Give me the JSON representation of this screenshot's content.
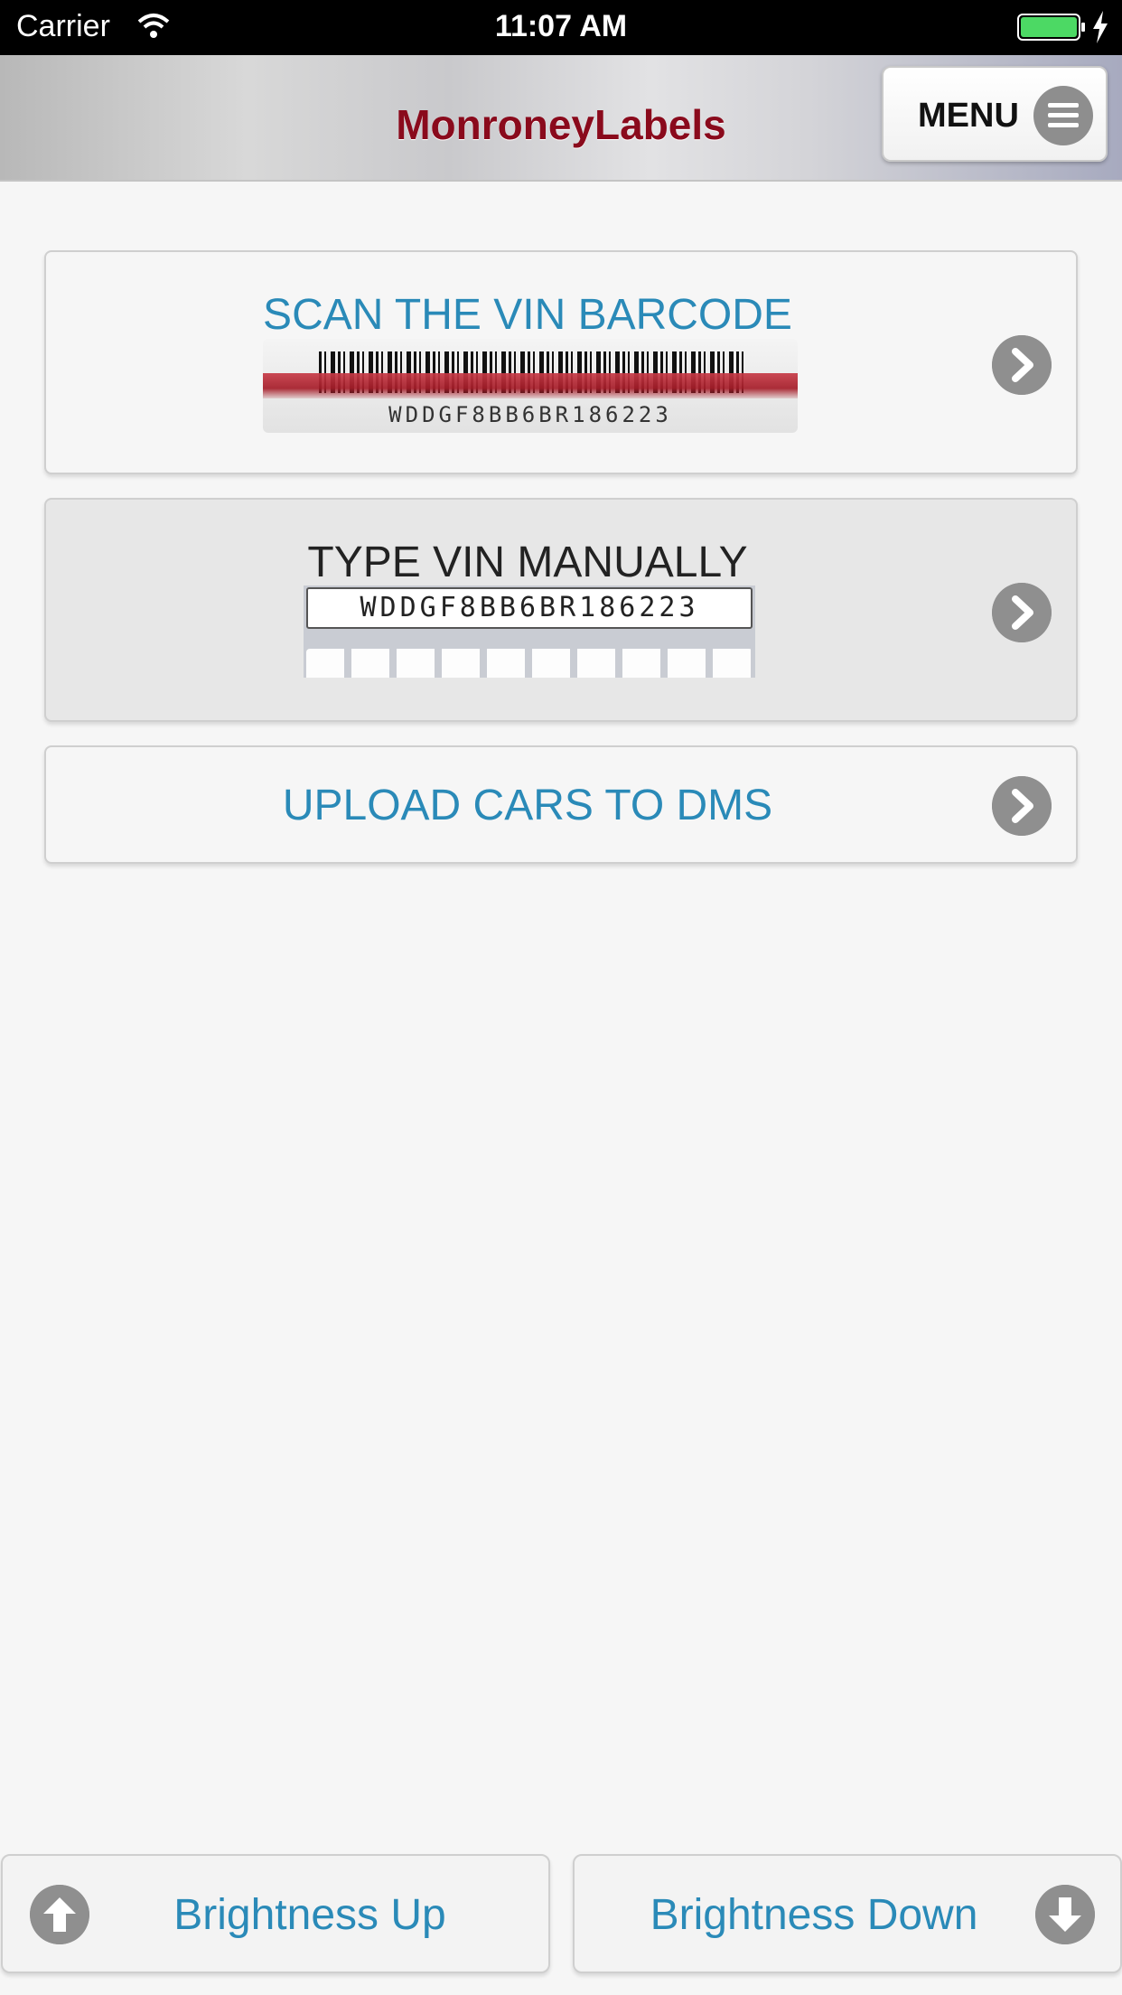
{
  "status_bar": {
    "carrier": "Carrier",
    "time": "11:07 AM",
    "battery_color": "#4cd964"
  },
  "header": {
    "title": "MonroneyLabels",
    "title_color": "#8a0a1c",
    "menu_label": "MENU",
    "menu_icon": "hamburger-icon"
  },
  "options": {
    "scan": {
      "label": "SCAN THE VIN BARCODE",
      "barcode_text": "WDDGF8BB6BR186223",
      "icon": "chevron-right-icon"
    },
    "type": {
      "label": "TYPE VIN MANUALLY",
      "vin_text": "WDDGF8BB6BR186223",
      "icon": "chevron-right-icon"
    },
    "upload": {
      "label": "UPLOAD CARS TO DMS",
      "icon": "chevron-right-icon"
    }
  },
  "footer": {
    "brightness_up": "Brightness Up",
    "brightness_down": "Brightness Down",
    "up_icon": "arrow-up-icon",
    "down_icon": "arrow-down-icon"
  },
  "colors": {
    "accent_blue": "#2a8ab8",
    "icon_gray": "#8f8f8f",
    "background": "#f6f6f6"
  }
}
